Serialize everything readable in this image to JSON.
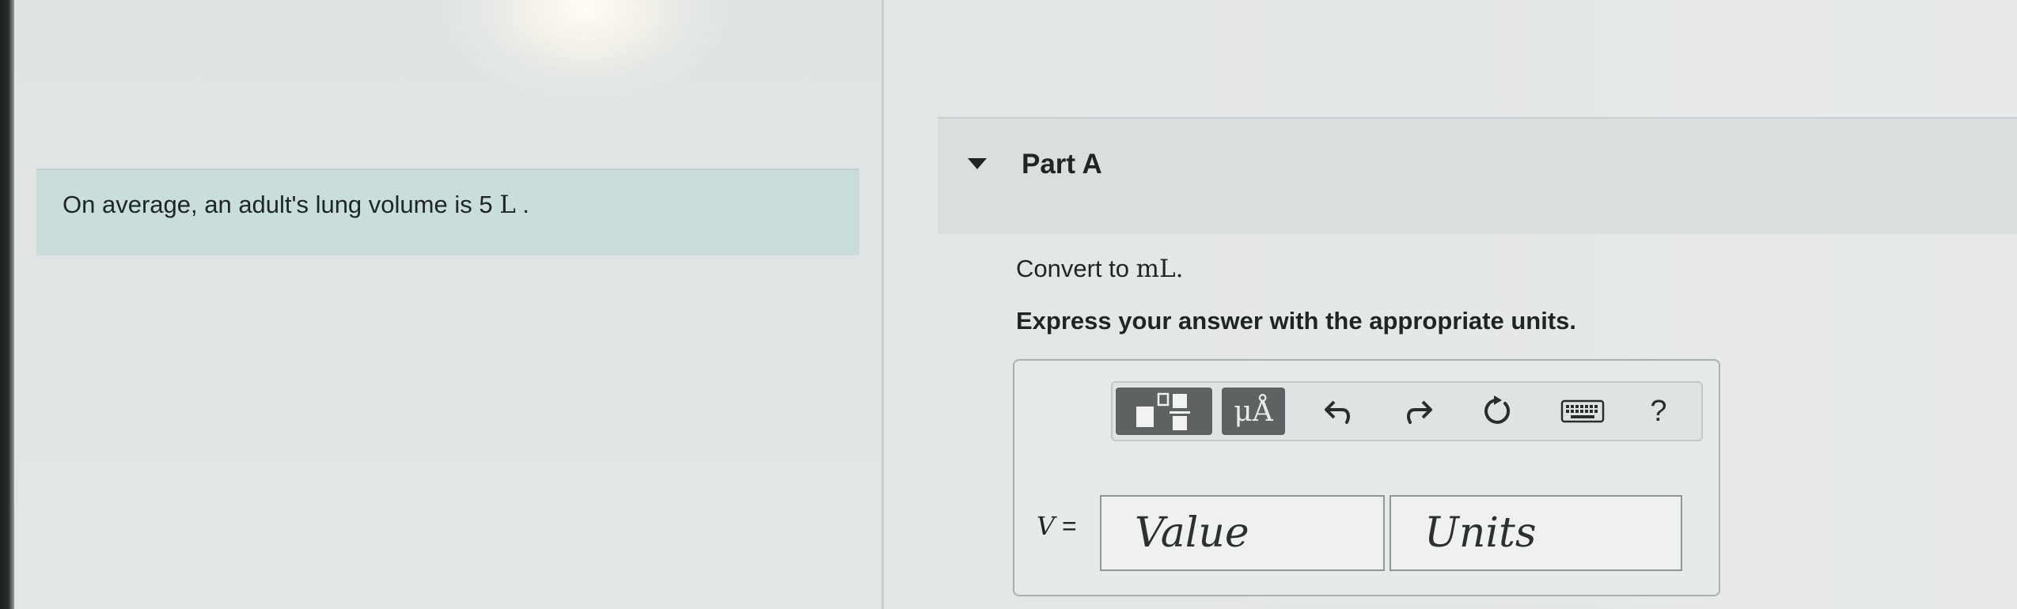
{
  "intro": {
    "text": "On average, an adult's lung volume is 5",
    "unit": "L",
    "suffix": " ."
  },
  "part": {
    "title": "Part A"
  },
  "question": {
    "prompt_prefix": "Convert to ",
    "prompt_unit": "mL",
    "prompt_suffix": ".",
    "instruction": "Express your answer with the appropriate units."
  },
  "toolbar": {
    "symbols_label": "μÅ",
    "help_label": "?",
    "icons": [
      "templates-icon",
      "undo-icon",
      "redo-icon",
      "reset-icon",
      "keyboard-icon"
    ]
  },
  "answer": {
    "variable": "V",
    "equals": " =",
    "value_placeholder": "Value",
    "units_placeholder": "Units"
  },
  "colors": {
    "intro_background": "#c9dedb",
    "toolbar_button": "#5f6262",
    "page_background": "#dde3e2"
  }
}
